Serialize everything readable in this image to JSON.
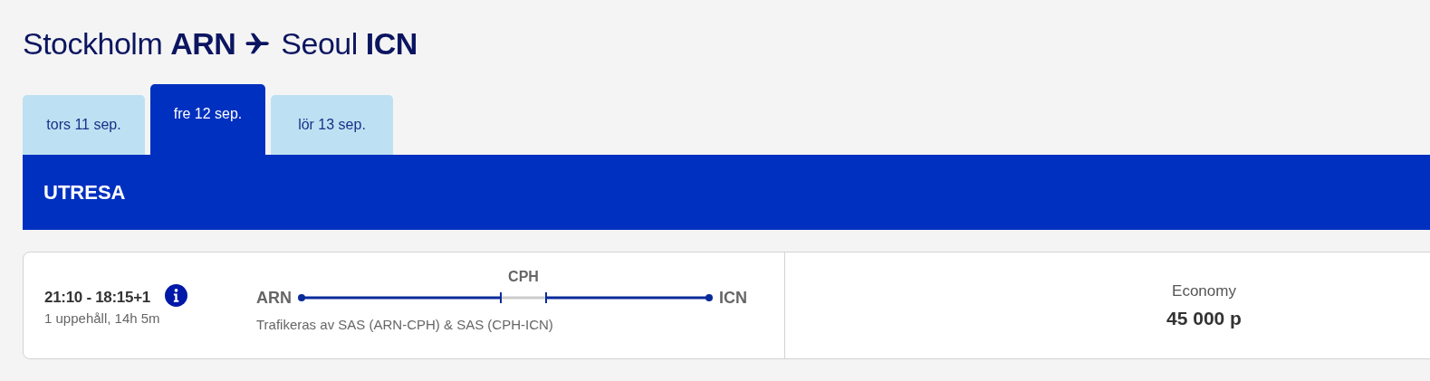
{
  "heading": {
    "origin": "Stockholm **ARN**",
    "destination": "Seoul **ICN**"
  },
  "date_tabs": [
    {
      "label": "tors 11 sep.",
      "selected": false
    },
    {
      "label": "fre 12 sep.",
      "selected": true
    },
    {
      "label": "lör 13 sep.",
      "selected": false
    }
  ],
  "section_title": "UTRESA",
  "flights": [
    {
      "times": "21:10 - 18:15+1",
      "summary": "1 uppehåll, 14h 5m",
      "from": "ARN",
      "to": "ICN",
      "stops": [
        "CPH"
      ],
      "operated_by": "Trafikeras av SAS (ARN-CPH) & SAS (CPH-ICN)",
      "fare_class": "Economy",
      "price": "45 000 p"
    }
  ]
}
